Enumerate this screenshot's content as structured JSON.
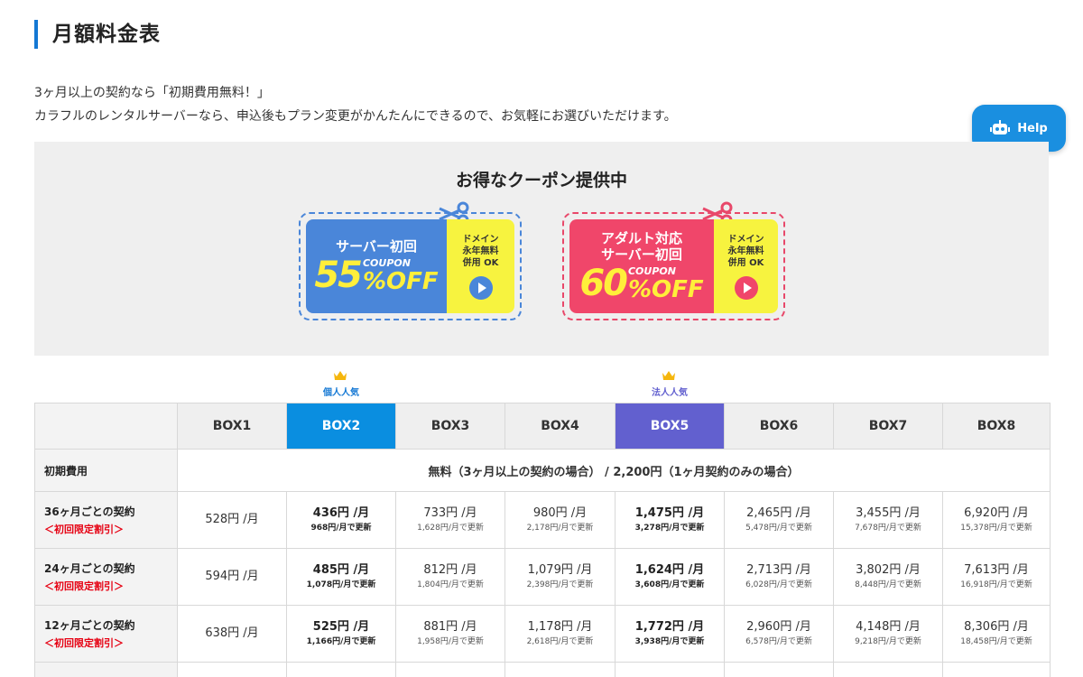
{
  "page": {
    "title": "月額料金表",
    "intro_line1": "3ヶ月以上の契約なら「初期費用無料！」",
    "intro_line2": "カラフルのレンタルサーバーなら、申込後もプラン変更がかんたんにできるので、お気軽にお選びいただけます。"
  },
  "help": {
    "label": "Help",
    "icon": "robot-icon"
  },
  "coupons": {
    "heading": "お得なクーポン提供中",
    "items": [
      {
        "title_line1": "サーバー初回",
        "title_line2": "",
        "percent": "55",
        "coupon_word": "COUPON",
        "off_word": "%OFF",
        "side_line1": "ドメイン",
        "side_line2": "永年無料",
        "side_line3": "併用 OK",
        "color": "#4a86d9"
      },
      {
        "title_line1": "アダルト対応",
        "title_line2": "サーバー初回",
        "percent": "60",
        "coupon_word": "COUPON",
        "off_word": "%OFF",
        "side_line1": "ドメイン",
        "side_line2": "永年無料",
        "side_line3": "併用 OK",
        "color": "#f0466a"
      }
    ]
  },
  "badges": {
    "box2": "個人人気",
    "box5": "法人人気"
  },
  "table": {
    "headers": [
      "BOX1",
      "BOX2",
      "BOX3",
      "BOX4",
      "BOX5",
      "BOX6",
      "BOX7",
      "BOX8"
    ],
    "initial_fee": {
      "label": "初期費用",
      "value": "無料（3ヶ月以上の契約の場合） / 2,200円（1ヶ月契約のみの場合）"
    },
    "plans": [
      {
        "label": "36ヶ月ごとの契約",
        "discount": "＜初回限定割引＞",
        "prices": [
          {
            "price": "528円 /月",
            "renew": ""
          },
          {
            "price": "436円 /月",
            "renew": "968円/月で更新"
          },
          {
            "price": "733円 /月",
            "renew": "1,628円/月で更新"
          },
          {
            "price": "980円 /月",
            "renew": "2,178円/月で更新"
          },
          {
            "price": "1,475円 /月",
            "renew": "3,278円/月で更新"
          },
          {
            "price": "2,465円 /月",
            "renew": "5,478円/月で更新"
          },
          {
            "price": "3,455円 /月",
            "renew": "7,678円/月で更新"
          },
          {
            "price": "6,920円 /月",
            "renew": "15,378円/月で更新"
          }
        ]
      },
      {
        "label": "24ヶ月ごとの契約",
        "discount": "＜初回限定割引＞",
        "prices": [
          {
            "price": "594円 /月",
            "renew": ""
          },
          {
            "price": "485円 /月",
            "renew": "1,078円/月で更新"
          },
          {
            "price": "812円 /月",
            "renew": "1,804円/月で更新"
          },
          {
            "price": "1,079円 /月",
            "renew": "2,398円/月で更新"
          },
          {
            "price": "1,624円 /月",
            "renew": "3,608円/月で更新"
          },
          {
            "price": "2,713円 /月",
            "renew": "6,028円/月で更新"
          },
          {
            "price": "3,802円 /月",
            "renew": "8,448円/月で更新"
          },
          {
            "price": "7,613円 /月",
            "renew": "16,918円/月で更新"
          }
        ]
      },
      {
        "label": "12ヶ月ごとの契約",
        "discount": "＜初回限定割引＞",
        "prices": [
          {
            "price": "638円 /月",
            "renew": ""
          },
          {
            "price": "525円 /月",
            "renew": "1,166円/月で更新"
          },
          {
            "price": "881円 /月",
            "renew": "1,958円/月で更新"
          },
          {
            "price": "1,178円 /月",
            "renew": "2,618円/月で更新"
          },
          {
            "price": "1,772円 /月",
            "renew": "3,938円/月で更新"
          },
          {
            "price": "2,960円 /月",
            "renew": "6,578円/月で更新"
          },
          {
            "price": "4,148円 /月",
            "renew": "9,218円/月で更新"
          },
          {
            "price": "8,306円 /月",
            "renew": "18,458円/月で更新"
          }
        ]
      }
    ]
  },
  "colors": {
    "accent_blue": "#0a8ee0",
    "accent_purple": "#6260cf",
    "discount_red": "#e60012"
  }
}
